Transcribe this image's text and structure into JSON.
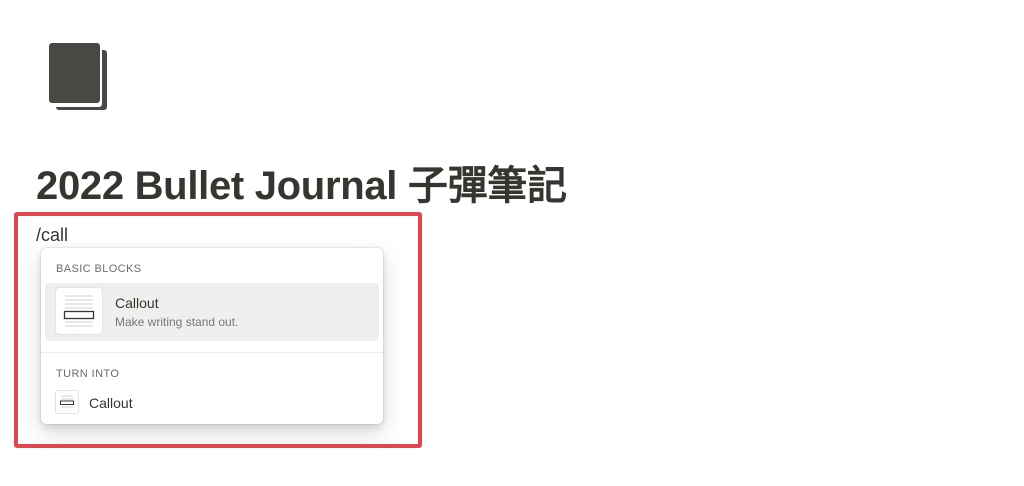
{
  "page": {
    "icon": "book-icon",
    "title": "2022 Bullet Journal 子彈筆記"
  },
  "editor": {
    "slash_command_text": "/call"
  },
  "slash_menu": {
    "sections": [
      {
        "header": "BASIC BLOCKS",
        "items": [
          {
            "label": "Callout",
            "description": "Make writing stand out.",
            "icon": "callout-block-icon",
            "selected": true
          }
        ]
      },
      {
        "header": "TURN INTO",
        "items": [
          {
            "label": "Callout",
            "icon": "callout-block-icon",
            "selected": false
          }
        ]
      }
    ]
  },
  "colors": {
    "text": "#37352f",
    "muted_text": "#787774",
    "highlight_frame": "#e0464d",
    "selected_row": "#efefee",
    "book_icon": "#4a4845"
  }
}
